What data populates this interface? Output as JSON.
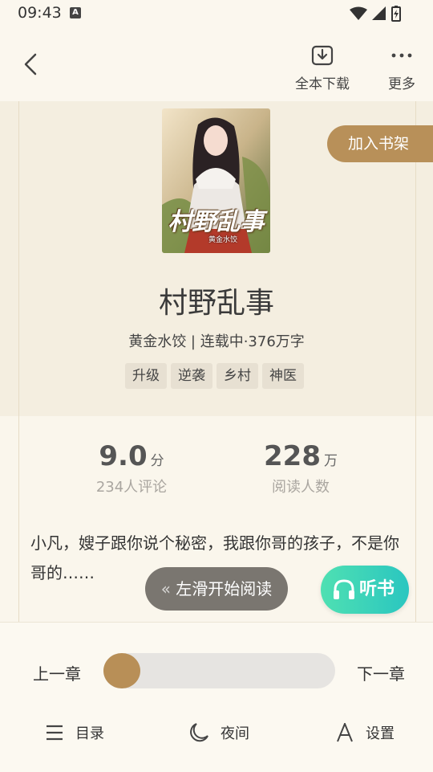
{
  "status": {
    "time": "09:43"
  },
  "toolbar": {
    "download_label": "全本下载",
    "more_label": "更多"
  },
  "book": {
    "title": "村野乱事",
    "cover_title": "村野乱事",
    "cover_author": "黄金水饺",
    "meta": "黄金水饺 | 连载中·376万字",
    "tags": [
      "升级",
      "逆袭",
      "乡村",
      "神医"
    ],
    "add_shelf_label": "加入书架"
  },
  "stats": {
    "score": "9.0",
    "score_unit": "分",
    "comments": "234人评论",
    "readers": "228",
    "readers_unit": "万",
    "readers_label": "阅读人数"
  },
  "intro": "小凡，嫂子跟你说个秘密，我跟你哥的孩子，不是你哥的……",
  "actions": {
    "swipe_label": "左滑开始阅读",
    "listen_label": "听书"
  },
  "chapter_nav": {
    "prev": "上一章",
    "next": "下一章",
    "progress": 0
  },
  "bottom_nav": {
    "toc": "目录",
    "night": "夜间",
    "settings": "设置"
  },
  "colors": {
    "accent": "#b89059",
    "listen": "#2ac6c0"
  }
}
